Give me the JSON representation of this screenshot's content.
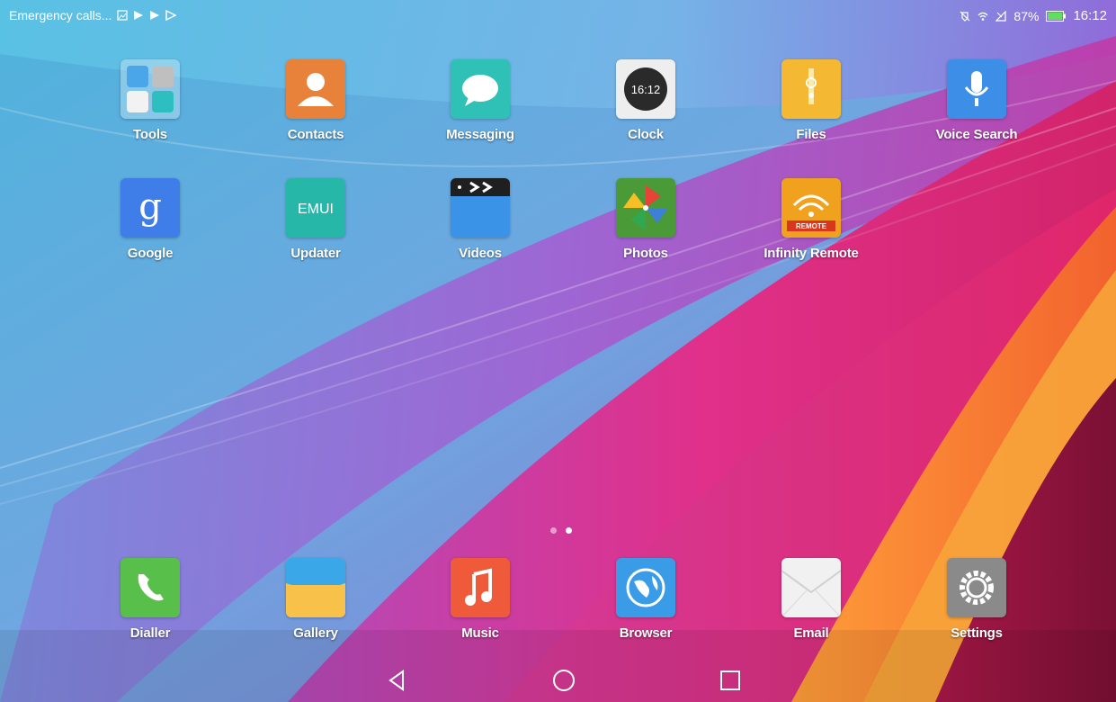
{
  "status": {
    "carrier_text": "Emergency calls...",
    "battery": "87%",
    "time": "16:12"
  },
  "apps": [
    {
      "label": "Tools",
      "icon": "tools-folder-icon"
    },
    {
      "label": "Contacts",
      "icon": "contacts-icon"
    },
    {
      "label": "Messaging",
      "icon": "messaging-icon"
    },
    {
      "label": "Clock",
      "icon": "clock-icon",
      "clock_time": "16:12"
    },
    {
      "label": "Files",
      "icon": "files-icon"
    },
    {
      "label": "Voice Search",
      "icon": "microphone-icon"
    },
    {
      "label": "Google",
      "icon": "google-icon",
      "glyph": "g"
    },
    {
      "label": "Updater",
      "icon": "updater-icon",
      "glyph": "EMUI"
    },
    {
      "label": "Videos",
      "icon": "videos-icon"
    },
    {
      "label": "Photos",
      "icon": "photos-icon"
    },
    {
      "label": "Infinity Remote",
      "icon": "infinity-remote-icon",
      "glyph": "REMOTE"
    }
  ],
  "dock": [
    {
      "label": "Dialler",
      "icon": "phone-icon"
    },
    {
      "label": "Gallery",
      "icon": "gallery-icon"
    },
    {
      "label": "Music",
      "icon": "music-icon"
    },
    {
      "label": "Browser",
      "icon": "browser-icon"
    },
    {
      "label": "Email",
      "icon": "email-icon"
    },
    {
      "label": "Settings",
      "icon": "settings-icon"
    }
  ],
  "page_indicator": {
    "count": 2,
    "active": 2
  },
  "nav": {
    "back": "back-icon",
    "home": "home-icon",
    "recents": "recents-icon"
  }
}
